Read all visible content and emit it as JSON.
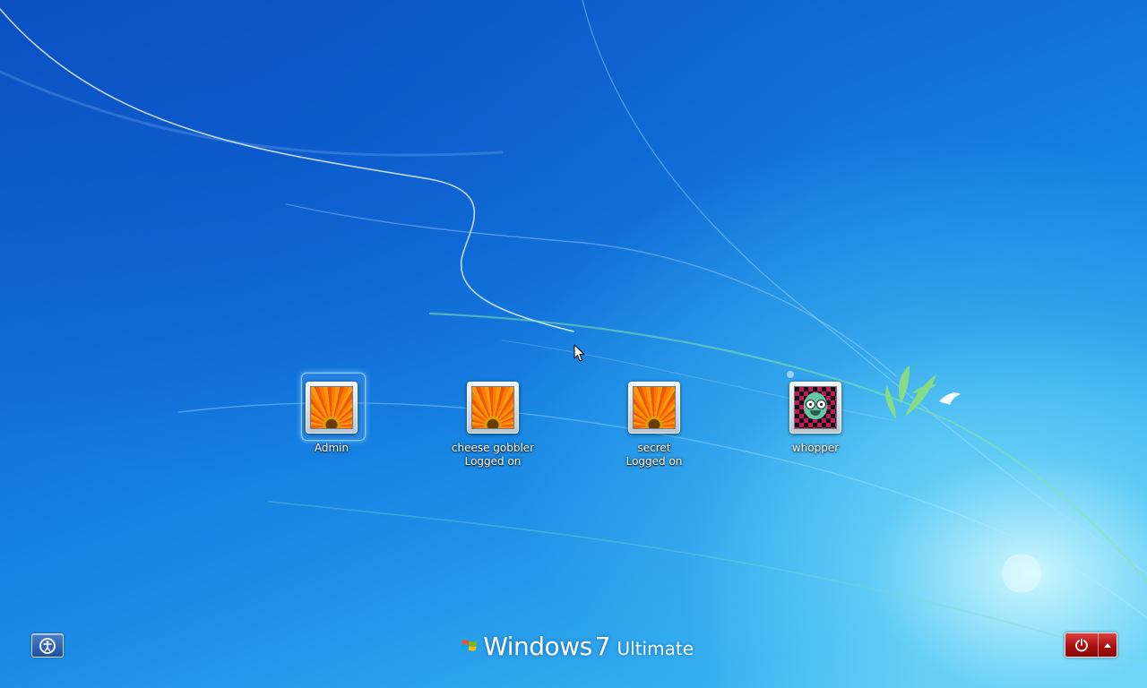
{
  "login_screen": {
    "users": [
      {
        "name": "Admin",
        "status": "",
        "picture": "orange-flower",
        "selected": true
      },
      {
        "name": "cheese gobbler",
        "status": "Logged on",
        "picture": "orange-flower",
        "selected": false
      },
      {
        "name": "secret",
        "status": "Logged on",
        "picture": "orange-flower",
        "selected": false
      },
      {
        "name": "whopper",
        "status": "",
        "picture": "gir-checkerboard",
        "selected": false
      }
    ],
    "branding": {
      "product": "Windows",
      "version": "7",
      "edition": "Ultimate"
    },
    "ease_of_access_icon": "ease-of-access-icon",
    "shutdown": {
      "icon": "power-icon",
      "options_icon": "arrow-up-icon"
    }
  },
  "colors": {
    "background_top": "#0b4fbf",
    "background_bottom": "#6cd2f6",
    "shutdown_red": "#a81010",
    "text": "#ffffff"
  }
}
